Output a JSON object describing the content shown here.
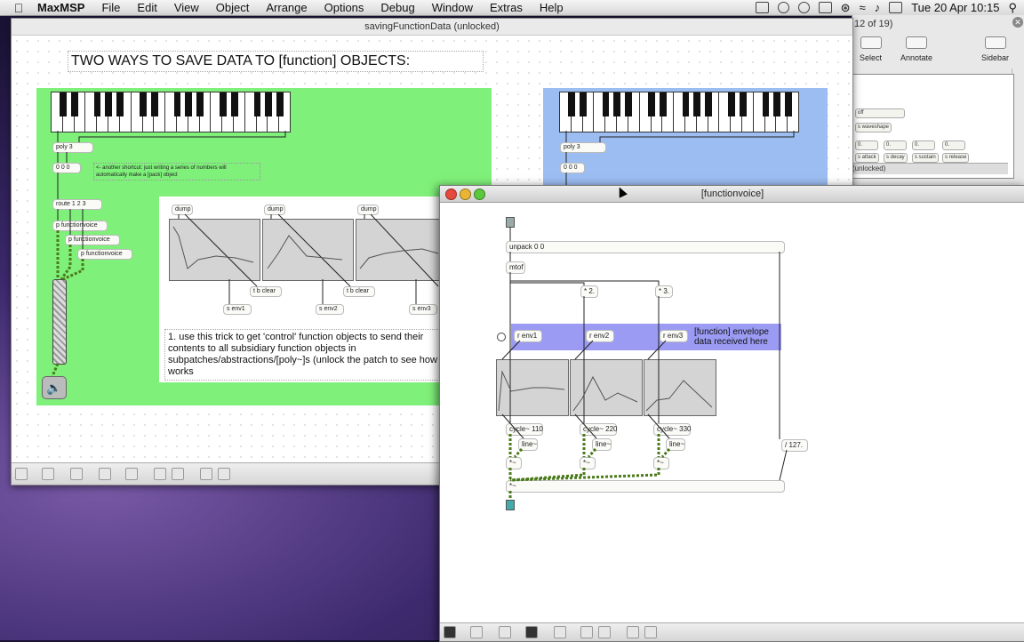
{
  "menubar": {
    "app_name": "MaxMSP",
    "items": [
      "File",
      "Edit",
      "View",
      "Object",
      "Arrange",
      "Options",
      "Debug",
      "Window",
      "Extras",
      "Help"
    ],
    "clock": "Tue 20 Apr  10:15"
  },
  "background_window": {
    "page_indicator": "12 of 19)",
    "toolbar": {
      "select": "Select",
      "annotate": "Annotate",
      "sidebar": "Sidebar"
    },
    "objects": {
      "menu": "off",
      "waveshape": "s waveshape",
      "num1": "0.",
      "num2": "0.",
      "num3": "0.",
      "num4": "0.",
      "attack": "s attack",
      "decay": "s decay",
      "sustain": "s sustain",
      "release": "s release"
    },
    "unlocked": "(unlocked)"
  },
  "main_window": {
    "title": "savingFunctionData (unlocked)",
    "heading": "TWO WAYS TO SAVE DATA TO [function] OBJECTS:",
    "left": {
      "poly": "poly 3",
      "pack": "0 0 0",
      "shortcut_comment": "<- another shortcut: just writing a series of numbers will automatically make a [pack] object",
      "route": "route 1 2 3",
      "voices": [
        "p functionvoice",
        "p functionvoice",
        "p functionvoice"
      ],
      "dumps": [
        "dump",
        "dump",
        "dump"
      ],
      "clears": [
        "t b clear",
        "t b clear"
      ],
      "senders": [
        "s env1",
        "s env2",
        "s env3"
      ],
      "comment": "1. use this trick to get 'control' function objects to send their contents to all subsidiary function objects in subpatches/abstractions/[poly~]s (unlock the patch to see how works"
    },
    "right": {
      "poly": "poly 3",
      "pack": "0 0 0"
    }
  },
  "function_window": {
    "title": "[functionvoice]",
    "unpack": "unpack 0 0",
    "mtof": "mtof",
    "mults": [
      "* 2.",
      "* 3."
    ],
    "receives": [
      "r env1",
      "r env2",
      "r env3"
    ],
    "comment": "[function] envelope data received here",
    "cycles": [
      "cycle~ 110",
      "cycle~ 220",
      "cycle~ 330"
    ],
    "lines": [
      "line~",
      "line~",
      "line~"
    ],
    "muls": [
      "*~",
      "*~",
      "*~"
    ],
    "div": "/ 127.",
    "sum": "*~"
  },
  "colors": {
    "green_panel": "#7ff07a",
    "blue_panel": "#9cbdf2",
    "purple_panel": "#9b9bf4"
  }
}
